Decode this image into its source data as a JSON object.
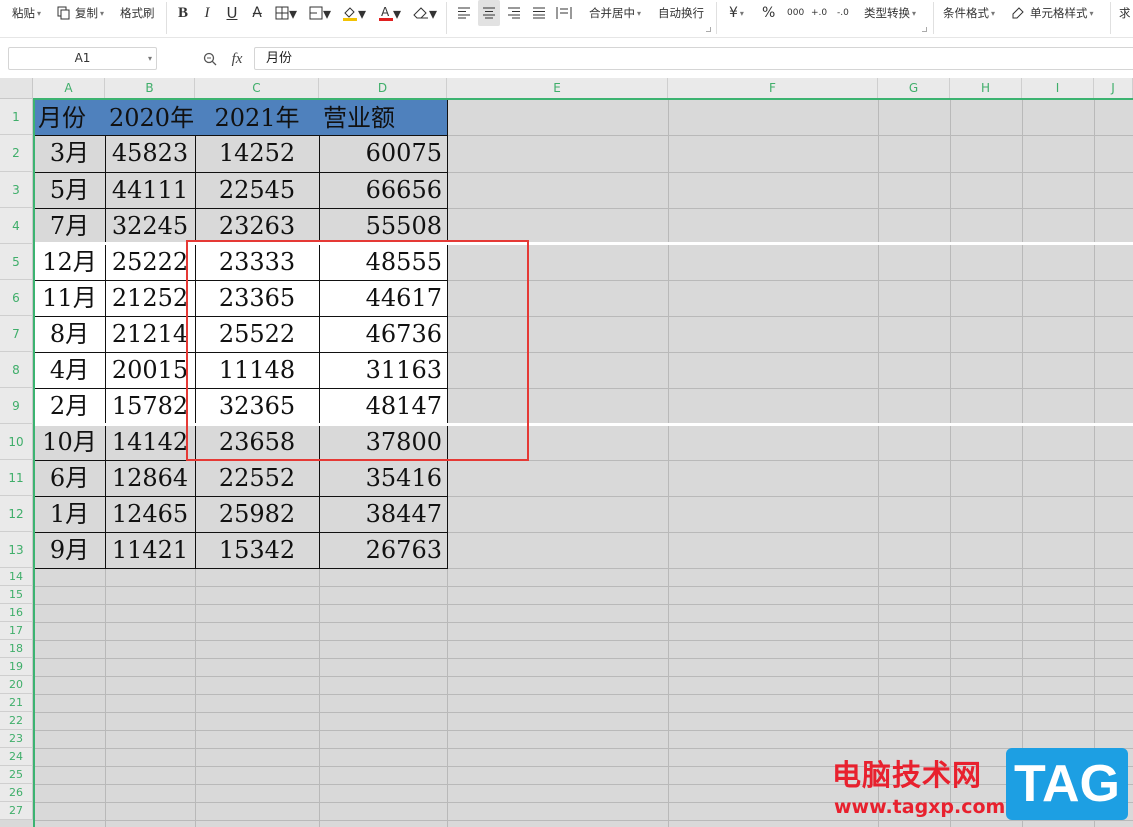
{
  "toolbar": {
    "paste_label": "粘贴",
    "copy_label": "复制",
    "format_painter_label": "格式刷",
    "merge_center_label": "合并居中",
    "wrap_text_label": "自动换行",
    "currency_symbol": "¥",
    "percent_symbol": "%",
    "thousands_label": "000",
    "dec_increase_label": "+.0",
    "dec_decrease_label": "-.0",
    "type_convert_label": "类型转换",
    "conditional_format_label": "条件格式",
    "cell_style_label": "单元格样式",
    "sum_label": "求"
  },
  "formula_bar": {
    "name_box": "A1",
    "fx_label": "fx",
    "value": "月份"
  },
  "columns": [
    "A",
    "B",
    "C",
    "D",
    "E",
    "F",
    "G",
    "H",
    "I",
    "J"
  ],
  "rows": [
    "1",
    "2",
    "3",
    "4",
    "5",
    "6",
    "7",
    "8",
    "9",
    "10",
    "11",
    "12",
    "13",
    "14",
    "15",
    "16",
    "17",
    "18",
    "19",
    "20",
    "21",
    "22",
    "23",
    "24",
    "25",
    "26",
    "27"
  ],
  "table": {
    "headers": [
      "月份",
      "2020年",
      "2021年",
      "营业额"
    ],
    "rows": [
      [
        "3月",
        "45823",
        "14252",
        "60075"
      ],
      [
        "5月",
        "44111",
        "22545",
        "66656"
      ],
      [
        "7月",
        "32245",
        "23263",
        "55508"
      ],
      [
        "12月",
        "25222",
        "23333",
        "48555"
      ],
      [
        "11月",
        "21252",
        "23365",
        "44617"
      ],
      [
        "8月",
        "21214",
        "25522",
        "46736"
      ],
      [
        "4月",
        "20015",
        "11148",
        "31163"
      ],
      [
        "2月",
        "15782",
        "32365",
        "48147"
      ],
      [
        "10月",
        "14142",
        "23658",
        "37800"
      ],
      [
        "6月",
        "12864",
        "22552",
        "35416"
      ],
      [
        "1月",
        "12465",
        "25982",
        "38447"
      ],
      [
        "9月",
        "11421",
        "15342",
        "26763"
      ]
    ]
  },
  "watermark": {
    "site_name": "电脑技术网",
    "url": "www.tagxp.com",
    "badge": "TAG"
  },
  "colors": {
    "header_fill": "#4f81bd",
    "grid_background": "#d9d9d9",
    "highlight_box": "#e53935",
    "selection_outline": "#3cb371"
  }
}
